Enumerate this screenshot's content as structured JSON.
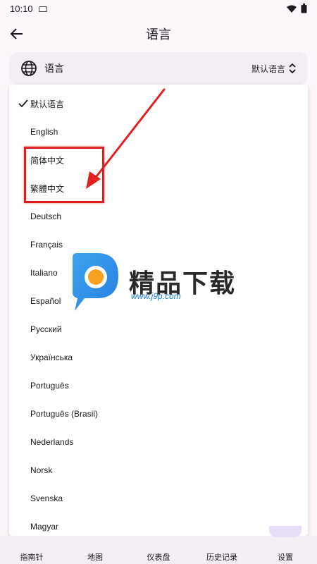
{
  "status_bar": {
    "time": "10:10"
  },
  "app_bar": {
    "title": "语言"
  },
  "setting": {
    "label": "语言",
    "value": "默认语言"
  },
  "languages": [
    "默认语言",
    "English",
    "简体中文",
    "繁體中文",
    "Deutsch",
    "Français",
    "Italiano",
    "Español",
    "Русский",
    "Українська",
    "Português",
    "Português (Brasil)",
    "Nederlands",
    "Norsk",
    "Svenska",
    "Magyar"
  ],
  "selected_index": 0,
  "bottom_nav": [
    "指南针",
    "地图",
    "仪表盘",
    "历史记录",
    "设置"
  ],
  "active_nav": "设置",
  "watermark": {
    "brand": "精品下载",
    "url": "www.j9p.com"
  },
  "colors": {
    "annotation": "#e02020",
    "accent": "#e8def8",
    "surface": "#f3edf4"
  }
}
